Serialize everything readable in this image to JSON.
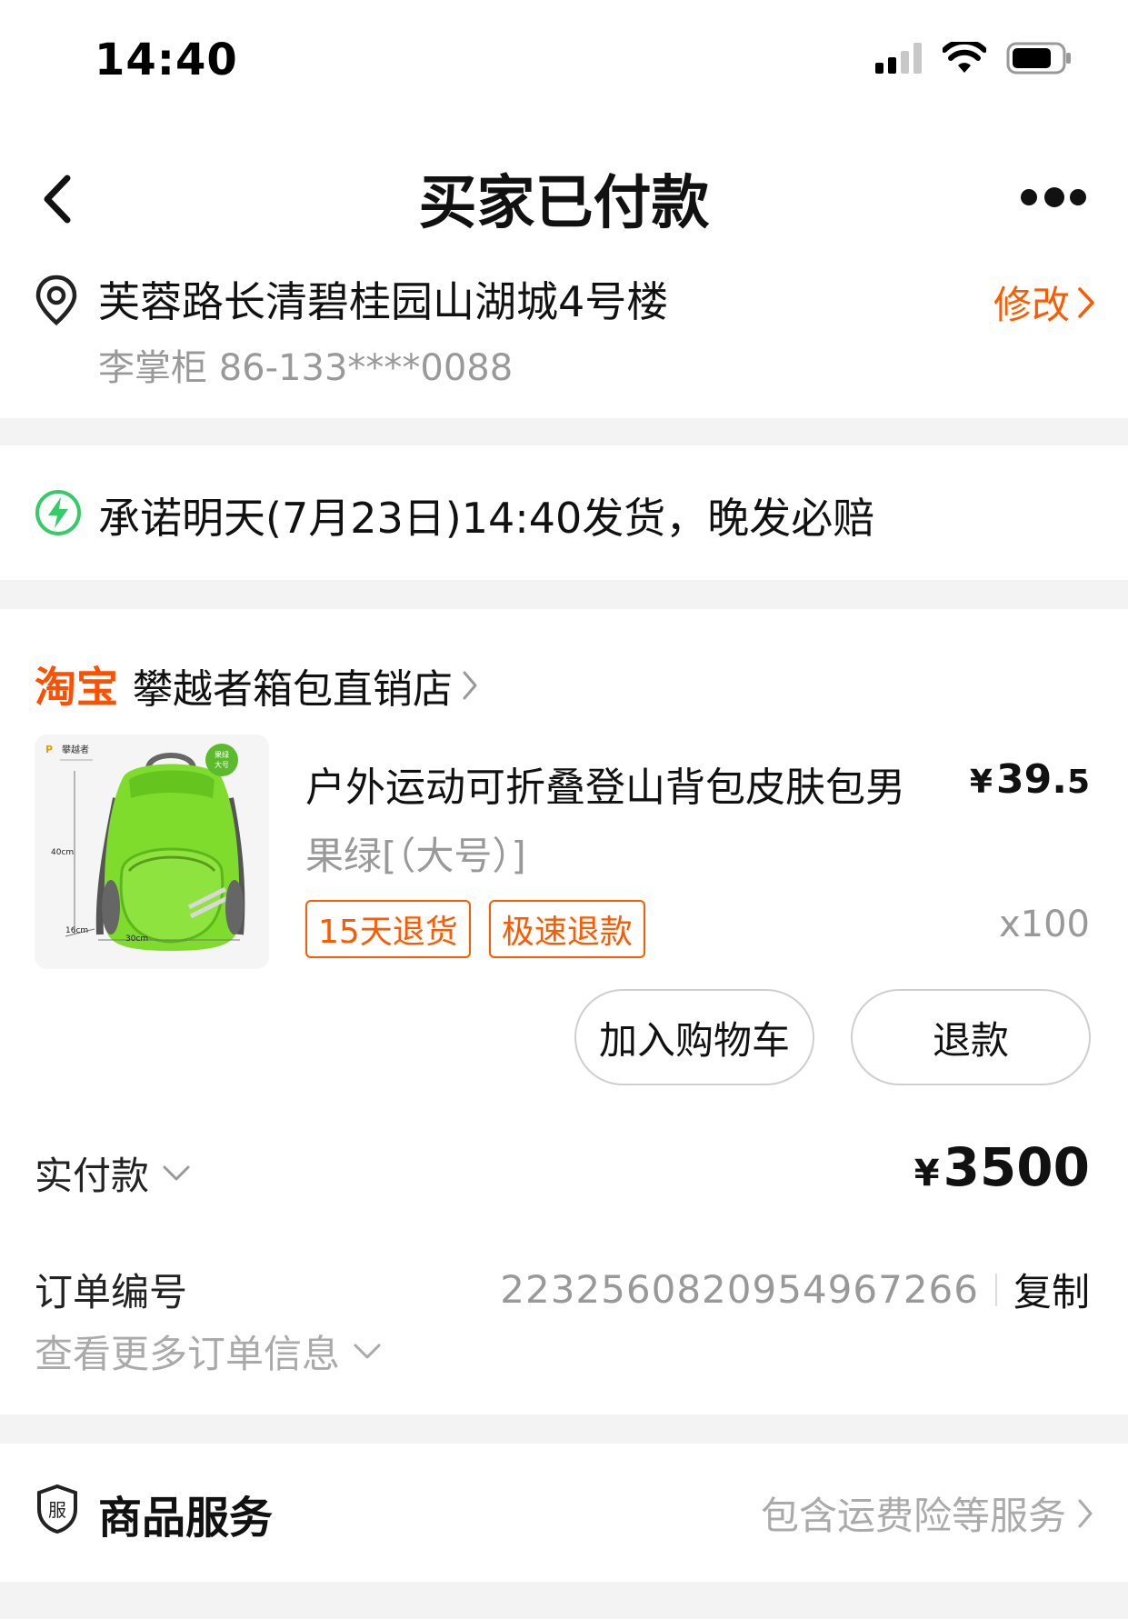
{
  "status_bar": {
    "time": "14:40"
  },
  "nav": {
    "title": "买家已付款"
  },
  "address": {
    "line": "芙蓉路长清碧桂园山湖城4号楼",
    "contact": "李掌柜 86-133****0088",
    "modify_label": "修改"
  },
  "promise": {
    "text": "承诺明天(7月23日)14:40发货，晚发必赔"
  },
  "shop": {
    "platform_logo": "淘宝",
    "name": "攀越者箱包直销店"
  },
  "product": {
    "title": "户外运动可折叠登山背包皮肤包男",
    "price_symbol": "¥",
    "price_int": "39.",
    "price_dec": "5",
    "spec": "果绿[（大号）]",
    "tags": [
      "15天退货",
      "极速退款"
    ],
    "quantity": "x100",
    "image_labels": {
      "brand": "攀越者",
      "badge_1": "果绿",
      "badge_2": "大号",
      "height": "40cm",
      "depth": "16cm",
      "width": "30cm"
    }
  },
  "actions": {
    "add_to_cart": "加入购物车",
    "refund": "退款"
  },
  "payment": {
    "label": "实付款",
    "symbol": "¥",
    "amount": "3500"
  },
  "order": {
    "label": "订单编号",
    "number": "2232560820954967266",
    "copy_label": "复制",
    "more_label": "查看更多订单信息"
  },
  "service": {
    "icon_char": "服",
    "title": "商品服务",
    "link": "包含运费险等服务"
  },
  "colors": {
    "accent": "#ff5a00",
    "taobao": "#ff5000",
    "green": "#33cc66",
    "gray_text": "#999999",
    "divider": "#f3f3f3"
  }
}
